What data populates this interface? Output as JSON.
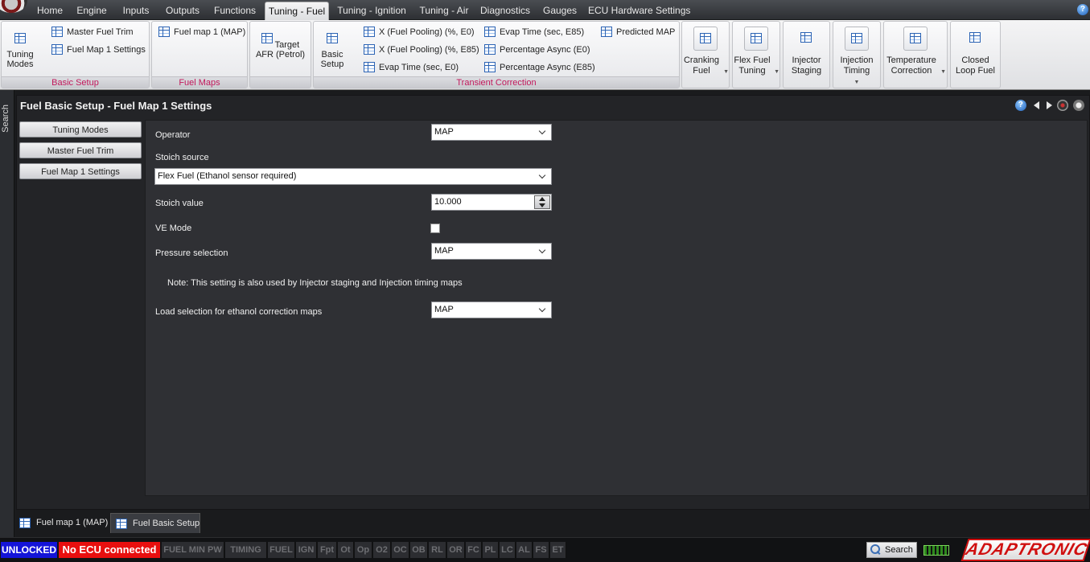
{
  "menu": {
    "tabs": [
      "Home",
      "Engine",
      "Inputs",
      "Outputs",
      "Functions",
      "Tuning - Fuel",
      "Tuning - Ignition",
      "Tuning - Air",
      "Diagnostics",
      "Gauges",
      "ECU Hardware Settings"
    ],
    "active": "Tuning - Fuel"
  },
  "ribbon": {
    "basic_setup": {
      "label": "Basic Setup",
      "tuning_modes": "Tuning Modes",
      "master_fuel_trim": "Master Fuel Trim",
      "fuel_map_1_settings": "Fuel Map 1 Settings"
    },
    "fuel_maps": {
      "label": "Fuel Maps",
      "fuel_map_1": "Fuel map 1 (MAP)"
    },
    "target_afr": "Target AFR (Petrol)",
    "transient": {
      "label": "Transient Correction",
      "basic_setup": "Basic Setup",
      "x_pooling_e0": "X (Fuel Pooling) (%, E0)",
      "x_pooling_e85": "X (Fuel Pooling) (%, E85)",
      "evap_e0": "Evap Time (sec, E0)",
      "evap_e85": "Evap Time (sec, E85)",
      "pct_async_e0": "Percentage Async (E0)",
      "pct_async_e85": "Percentage Async (E85)",
      "predicted_map": "Predicted MAP"
    },
    "tiles": {
      "cranking_fuel": "Cranking Fuel",
      "flex_fuel_tuning": "Flex Fuel Tuning",
      "injector_staging": "Injector Staging",
      "injection_timing": "Injection Timing",
      "temperature_correction": "Temperature Correction",
      "closed_loop_fuel": "Closed Loop Fuel"
    }
  },
  "search_strip": "Search",
  "panel": {
    "title": "Fuel Basic Setup - Fuel Map 1 Settings",
    "nav": [
      "Tuning Modes",
      "Master Fuel Trim",
      "Fuel Map 1 Settings"
    ],
    "form": {
      "operator_label": "Operator",
      "operator_value": "MAP",
      "stoich_source_label": "Stoich source",
      "stoich_source_value": "Flex Fuel (Ethanol sensor required)",
      "stoich_value_label": "Stoich value",
      "stoich_value": "10.000",
      "ve_mode_label": "VE Mode",
      "ve_mode_checked": false,
      "pressure_label": "Pressure selection",
      "pressure_value": "MAP",
      "note": "Note: This setting is also used by Injector staging and Injection timing maps",
      "load_label": "Load selection for ethanol correction maps",
      "load_value": "MAP"
    }
  },
  "doc_tabs": [
    "Fuel map 1 (MAP)",
    "Fuel Basic Setup"
  ],
  "status": {
    "lock": "UNLOCKED",
    "ecu": "No ECU connected",
    "flags": [
      "FUEL MIN PW",
      "TIMING",
      "FUEL",
      "IGN",
      "Fpt",
      "Ot",
      "Op",
      "O2",
      "OC",
      "OB",
      "RL",
      "OR",
      "FC",
      "PL",
      "LC",
      "AL",
      "FS",
      "ET"
    ],
    "search": "Search",
    "brand": "ADAPTRONIC"
  },
  "colors": {
    "accent_label": "#c2185b",
    "unlocked_bg": "#1414d8",
    "no_ecu_bg": "#e80f0f"
  }
}
